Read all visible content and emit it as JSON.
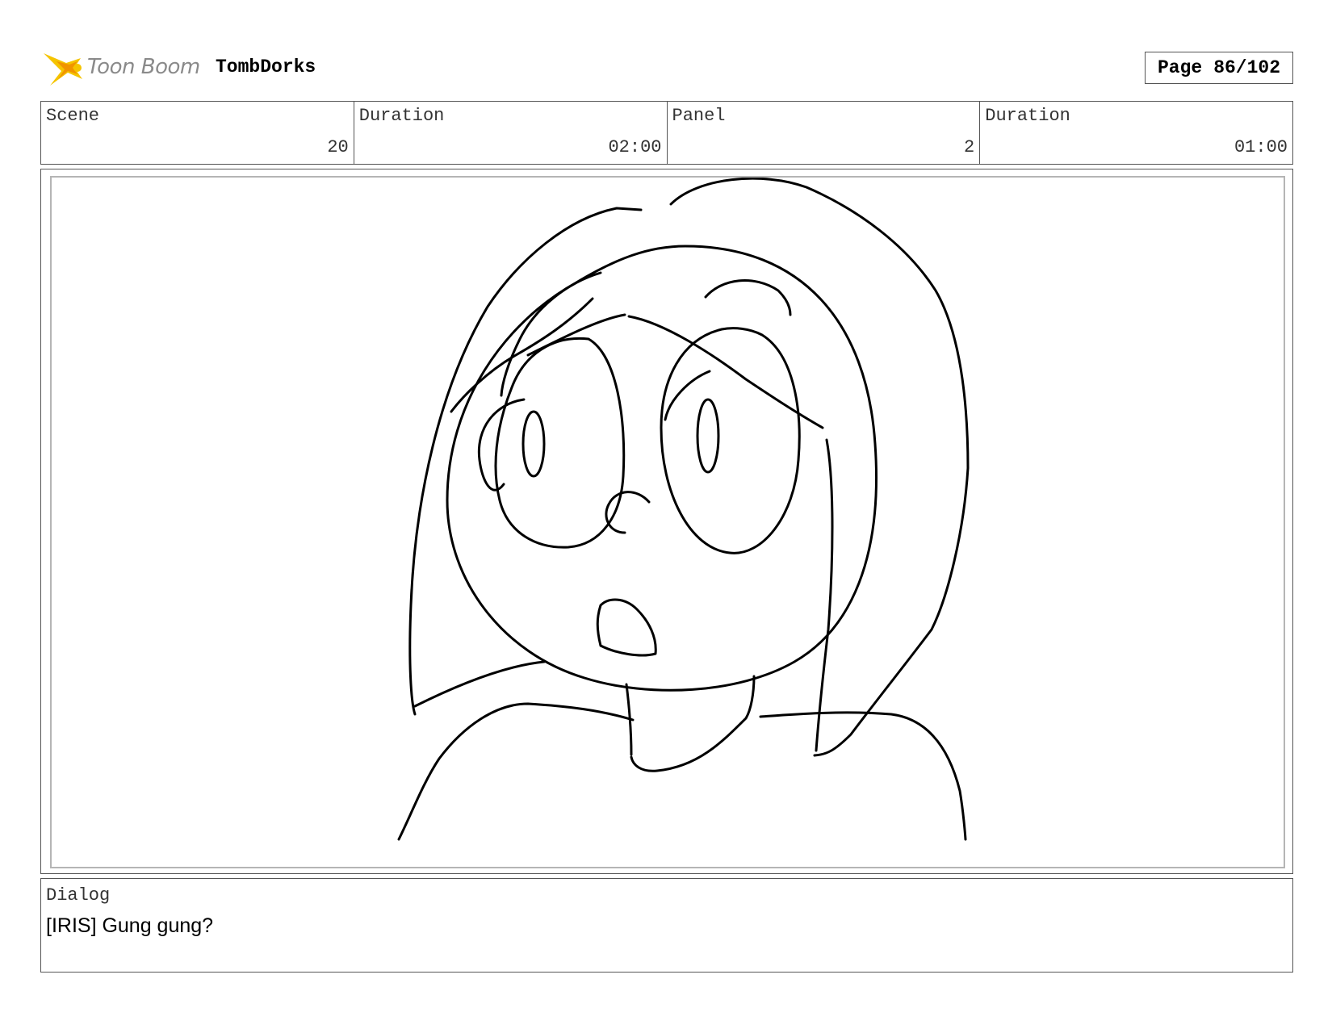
{
  "header": {
    "logo_text": "Toon Boom",
    "project_title": "TombDorks",
    "page_label": "Page",
    "page_number": "86/102"
  },
  "info": {
    "scene_label": "Scene",
    "scene_value": "20",
    "scene_duration_label": "Duration",
    "scene_duration_value": "02:00",
    "panel_label": "Panel",
    "panel_value": "2",
    "panel_duration_label": "Duration",
    "panel_duration_value": "01:00"
  },
  "dialog": {
    "label": "Dialog",
    "text": "[IRIS] Gung gung?"
  },
  "colors": {
    "logo_yellow": "#f5c400",
    "logo_orange": "#f08c00",
    "logo_text": "#8a8a8a",
    "border": "#555555",
    "inner_frame": "#b5b5b5"
  },
  "icons": {
    "logo": "toon-boom-star-icon"
  }
}
